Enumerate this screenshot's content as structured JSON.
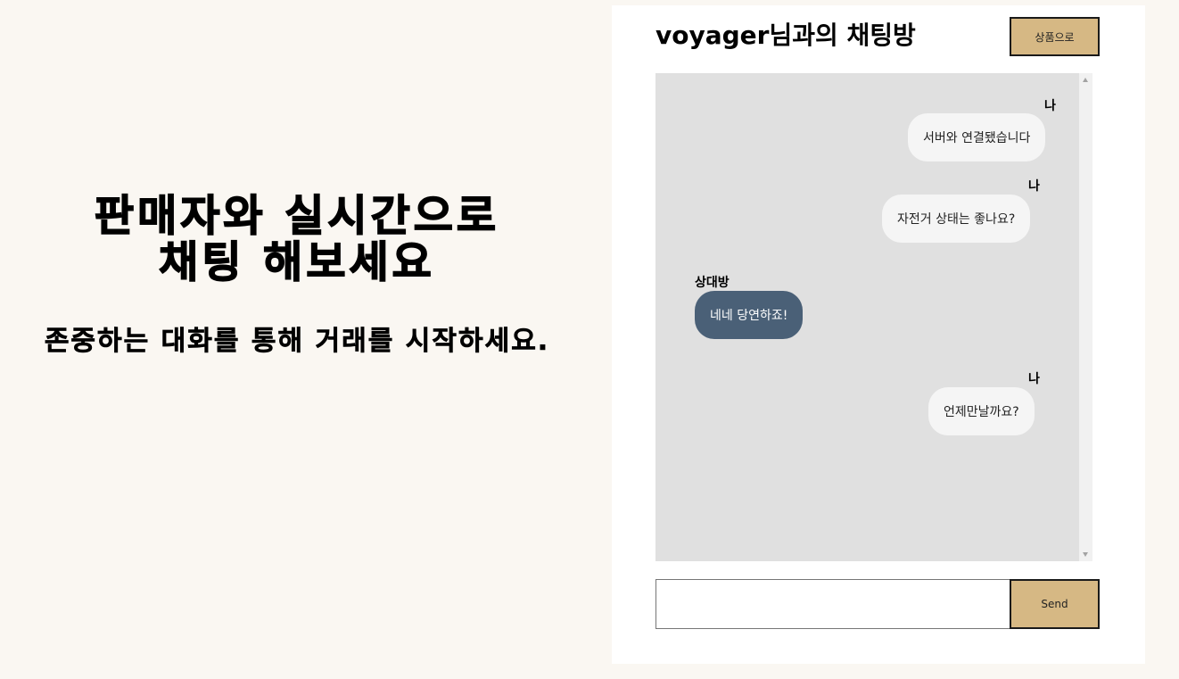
{
  "hero": {
    "title_line1": "판매자와 실시간으로",
    "title_line2": "채팅 해보세요",
    "subtitle": "존중하는 대화를 통해 거래를 시작하세요."
  },
  "chat": {
    "room_title": "voyager님과의 채팅방",
    "to_product_label": "상품으로",
    "messages": [
      {
        "sender": "나",
        "text": "서버와 연결됐습니다",
        "mine": true
      },
      {
        "sender": "나",
        "text": "자전거 상태는 좋나요?",
        "mine": true
      },
      {
        "sender": "상대방",
        "text": "네네 당연하죠!",
        "mine": false
      },
      {
        "sender": "나",
        "text": "언제만날까요?",
        "mine": true
      }
    ],
    "input_value": "",
    "send_label": "Send"
  },
  "colors": {
    "background": "#faf7f2",
    "accent_button": "#d6b884",
    "chat_area": "#e0e0e0",
    "my_bubble": "#f5f5f5",
    "their_bubble": "#4a6077"
  }
}
